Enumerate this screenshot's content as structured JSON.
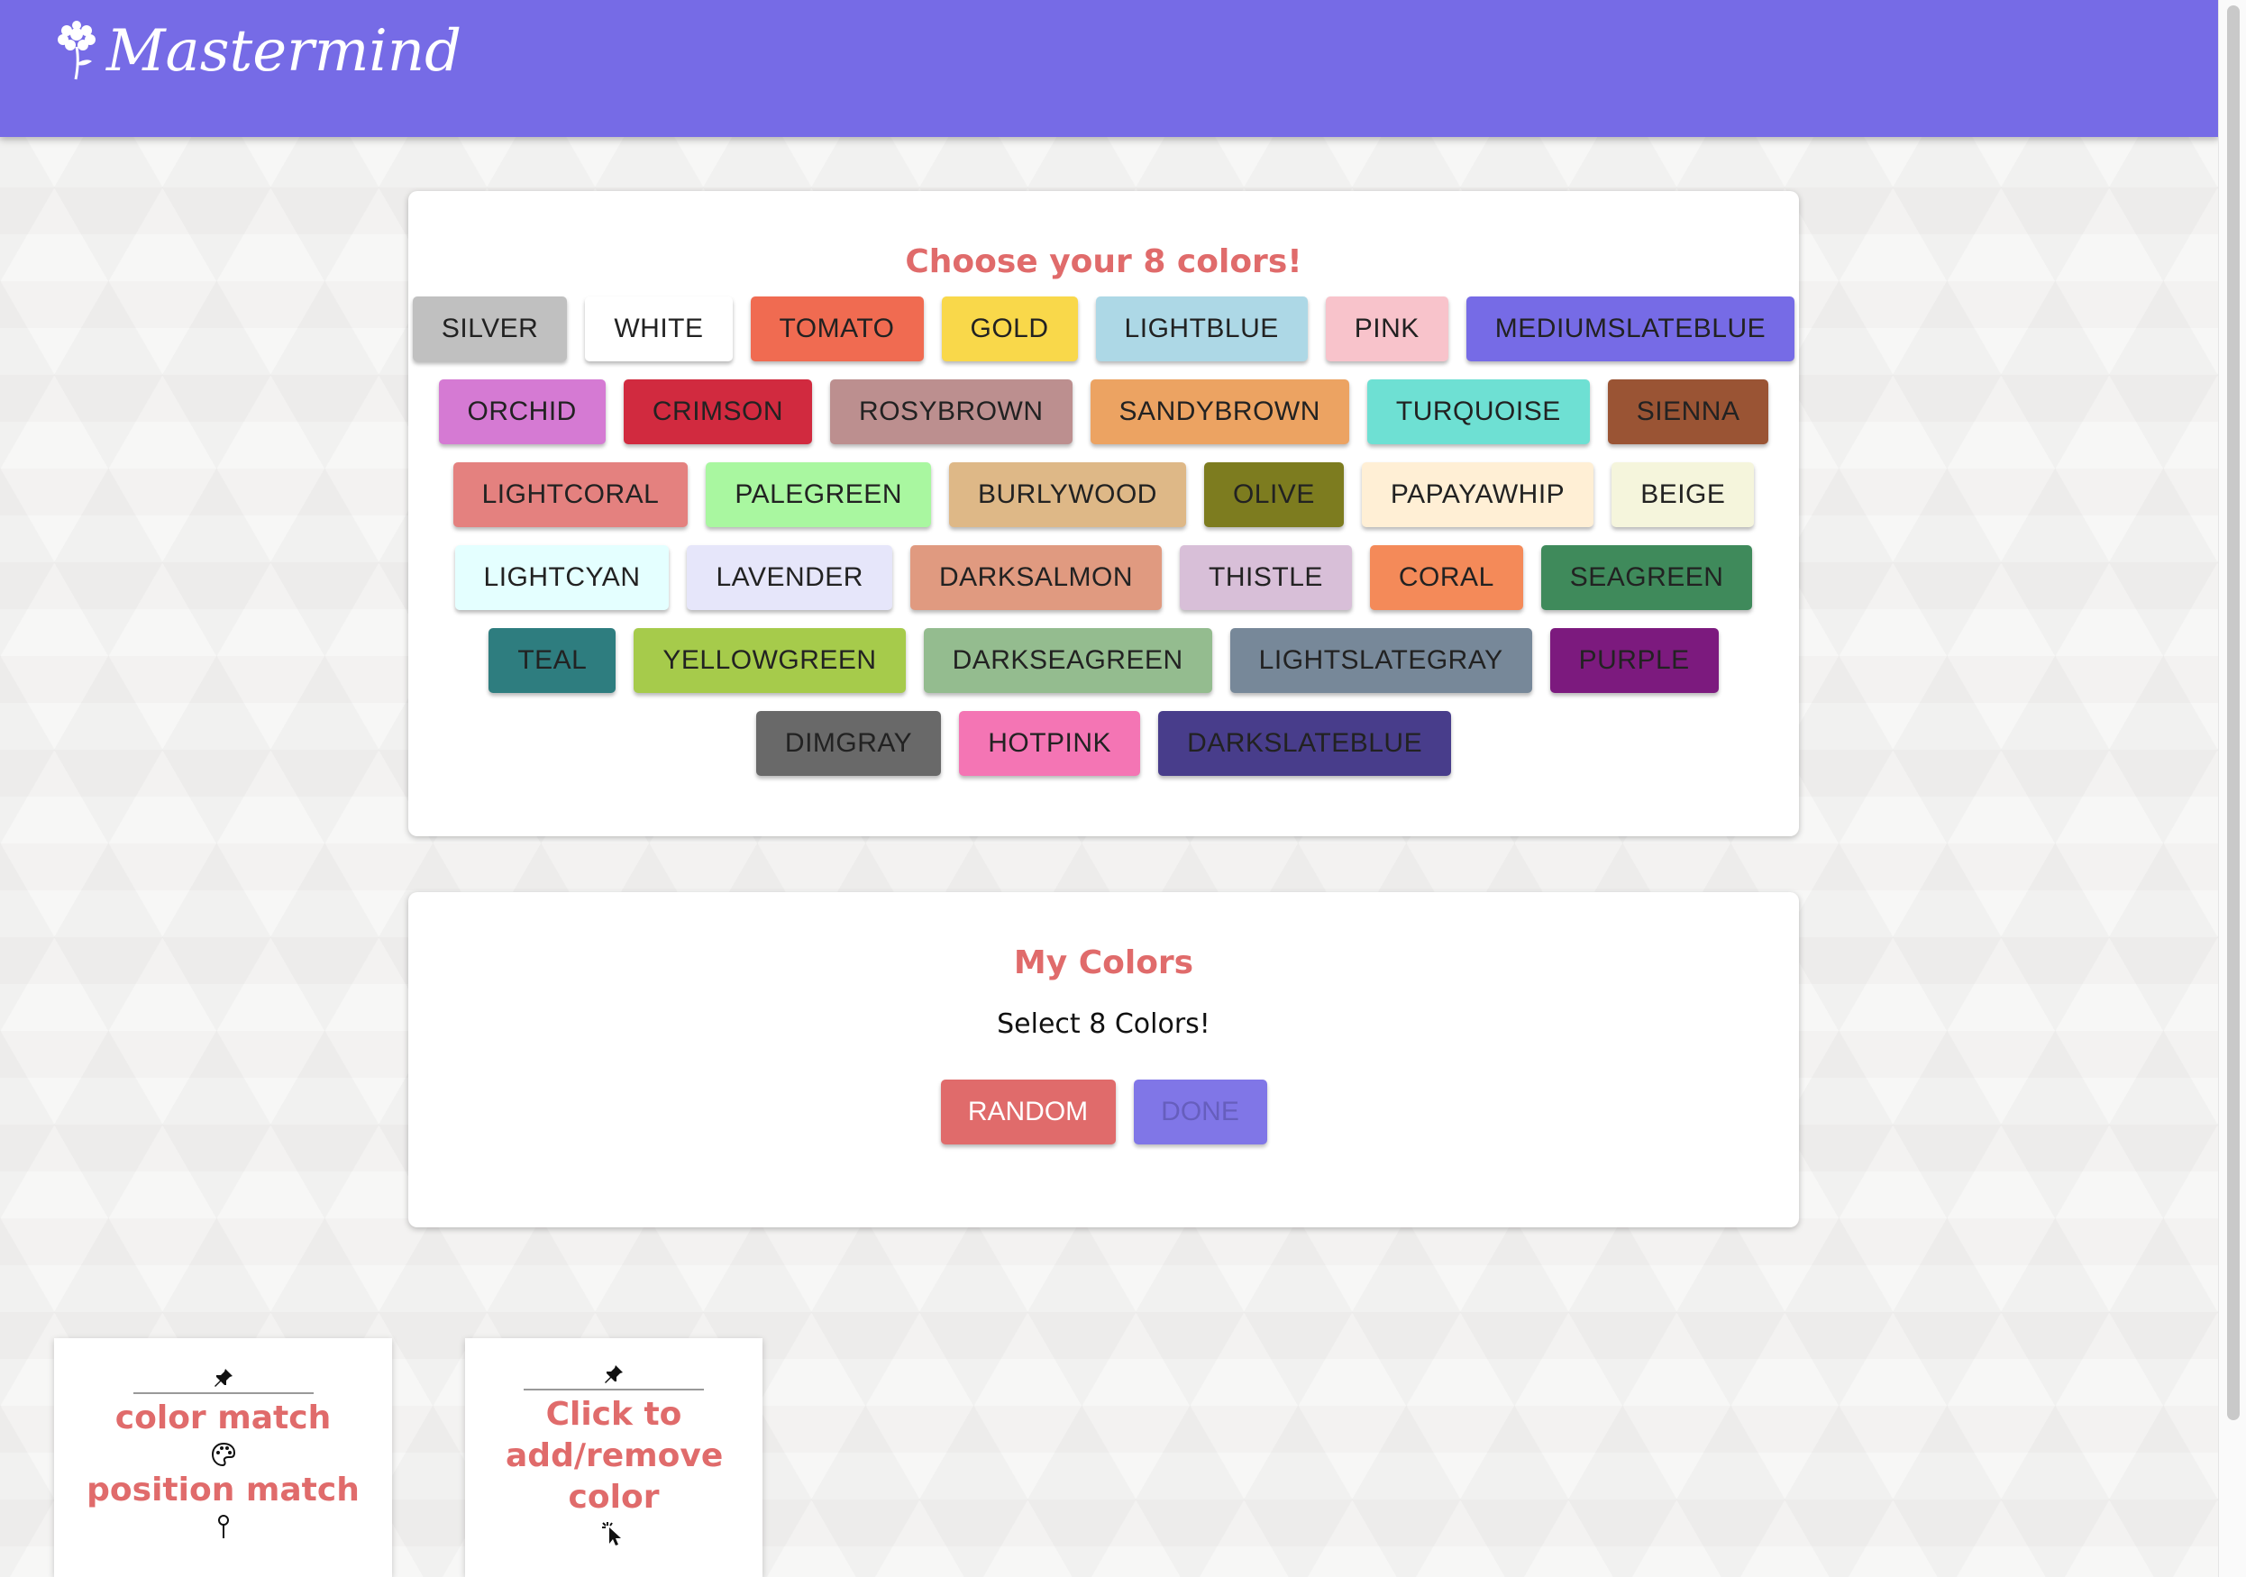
{
  "app": {
    "title": "Mastermind"
  },
  "choose": {
    "title": "Choose your 8 colors!",
    "rows": [
      [
        {
          "label": "SILVER",
          "bg": "#c0c0c0",
          "fg": "#222"
        },
        {
          "label": "WHITE",
          "bg": "#ffffff",
          "fg": "#222"
        },
        {
          "label": "TOMATO",
          "bg": "#f06b51",
          "fg": "#222"
        },
        {
          "label": "GOLD",
          "bg": "#f9d84a",
          "fg": "#222"
        },
        {
          "label": "LIGHTBLUE",
          "bg": "#add8e6",
          "fg": "#222"
        },
        {
          "label": "PINK",
          "bg": "#f8c3cb",
          "fg": "#222"
        },
        {
          "label": "MEDIUMSLATEBLUE",
          "bg": "#766be6",
          "fg": "#222"
        }
      ],
      [
        {
          "label": "ORCHID",
          "bg": "#d57ad3",
          "fg": "#222"
        },
        {
          "label": "CRIMSON",
          "bg": "#d12a3f",
          "fg": "#222"
        },
        {
          "label": "ROSYBROWN",
          "bg": "#bc8f8f",
          "fg": "#222"
        },
        {
          "label": "SANDYBROWN",
          "bg": "#eca362",
          "fg": "#222"
        },
        {
          "label": "TURQUOISE",
          "bg": "#6ee0d3",
          "fg": "#222"
        },
        {
          "label": "SIENNA",
          "bg": "#9a5434",
          "fg": "#222"
        }
      ],
      [
        {
          "label": "LIGHTCORAL",
          "bg": "#e4817f",
          "fg": "#222"
        },
        {
          "label": "PALEGREEN",
          "bg": "#a9f7a0",
          "fg": "#222"
        },
        {
          "label": "BURLYWOOD",
          "bg": "#deb887",
          "fg": "#222"
        },
        {
          "label": "OLIVE",
          "bg": "#7d7c1f",
          "fg": "#222"
        },
        {
          "label": "PAPAYAWHIP",
          "bg": "#ffefd5",
          "fg": "#222"
        },
        {
          "label": "BEIGE",
          "bg": "#f5f5dc",
          "fg": "#222"
        }
      ],
      [
        {
          "label": "LIGHTCYAN",
          "bg": "#e4ffff",
          "fg": "#222"
        },
        {
          "label": "LAVENDER",
          "bg": "#e6e6fa",
          "fg": "#222"
        },
        {
          "label": "DARKSALMON",
          "bg": "#e09a80",
          "fg": "#222"
        },
        {
          "label": "THISTLE",
          "bg": "#d8bfd8",
          "fg": "#222"
        },
        {
          "label": "CORAL",
          "bg": "#f48a59",
          "fg": "#222"
        },
        {
          "label": "SEAGREEN",
          "bg": "#3f8a5b",
          "fg": "#222"
        }
      ],
      [
        {
          "label": "TEAL",
          "bg": "#2e7d7f",
          "fg": "#222"
        },
        {
          "label": "YELLOWGREEN",
          "bg": "#a6cb4b",
          "fg": "#222"
        },
        {
          "label": "DARKSEAGREEN",
          "bg": "#94bc8f",
          "fg": "#222"
        },
        {
          "label": "LIGHTSLATEGRAY",
          "bg": "#778899",
          "fg": "#222"
        },
        {
          "label": "PURPLE",
          "bg": "#7c1a7e",
          "fg": "#222"
        }
      ],
      [
        {
          "label": "DIMGRAY",
          "bg": "#696969",
          "fg": "#222"
        },
        {
          "label": "HOTPINK",
          "bg": "#f475b4",
          "fg": "#222"
        },
        {
          "label": "DARKSLATEBLUE",
          "bg": "#483d8b",
          "fg": "#222"
        }
      ]
    ]
  },
  "mine": {
    "title": "My Colors",
    "subtitle": "Select 8 Colors!",
    "random_label": "RANDOM",
    "done_label": "DONE"
  },
  "notes": {
    "legend": {
      "line1": "color match",
      "line2": "position match"
    },
    "hint": {
      "text": "Click to add/remove color"
    }
  },
  "colors": {
    "accent": "#766be6",
    "title_red": "#e06b6b"
  }
}
